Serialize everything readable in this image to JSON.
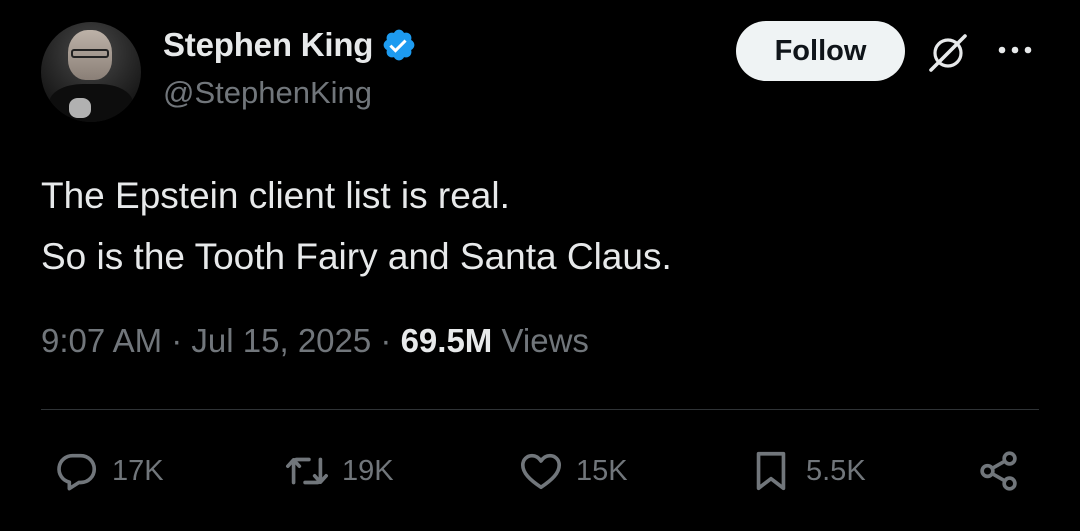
{
  "author": {
    "display_name": "Stephen King",
    "handle": "@StephenKing",
    "verified": true,
    "verified_color": "#1d9bf0"
  },
  "header": {
    "follow_label": "Follow",
    "grok_icon": "grok-icon",
    "more_icon": "more-icon"
  },
  "tweet": {
    "lines": [
      "The Epstein client list is real.",
      "So is the Tooth Fairy and Santa Claus."
    ],
    "time": "9:07 AM",
    "date": "Jul 15, 2025",
    "separator": "·",
    "views_count": "69.5M",
    "views_label": "Views"
  },
  "actions": {
    "reply_count": "17K",
    "retweet_count": "19K",
    "like_count": "15K",
    "bookmark_count": "5.5K"
  },
  "theme": {
    "background": "#000000",
    "text_primary": "#e7e9ea",
    "text_secondary": "#71767b",
    "divider": "#2f3336",
    "follow_bg": "#eff3f4"
  }
}
